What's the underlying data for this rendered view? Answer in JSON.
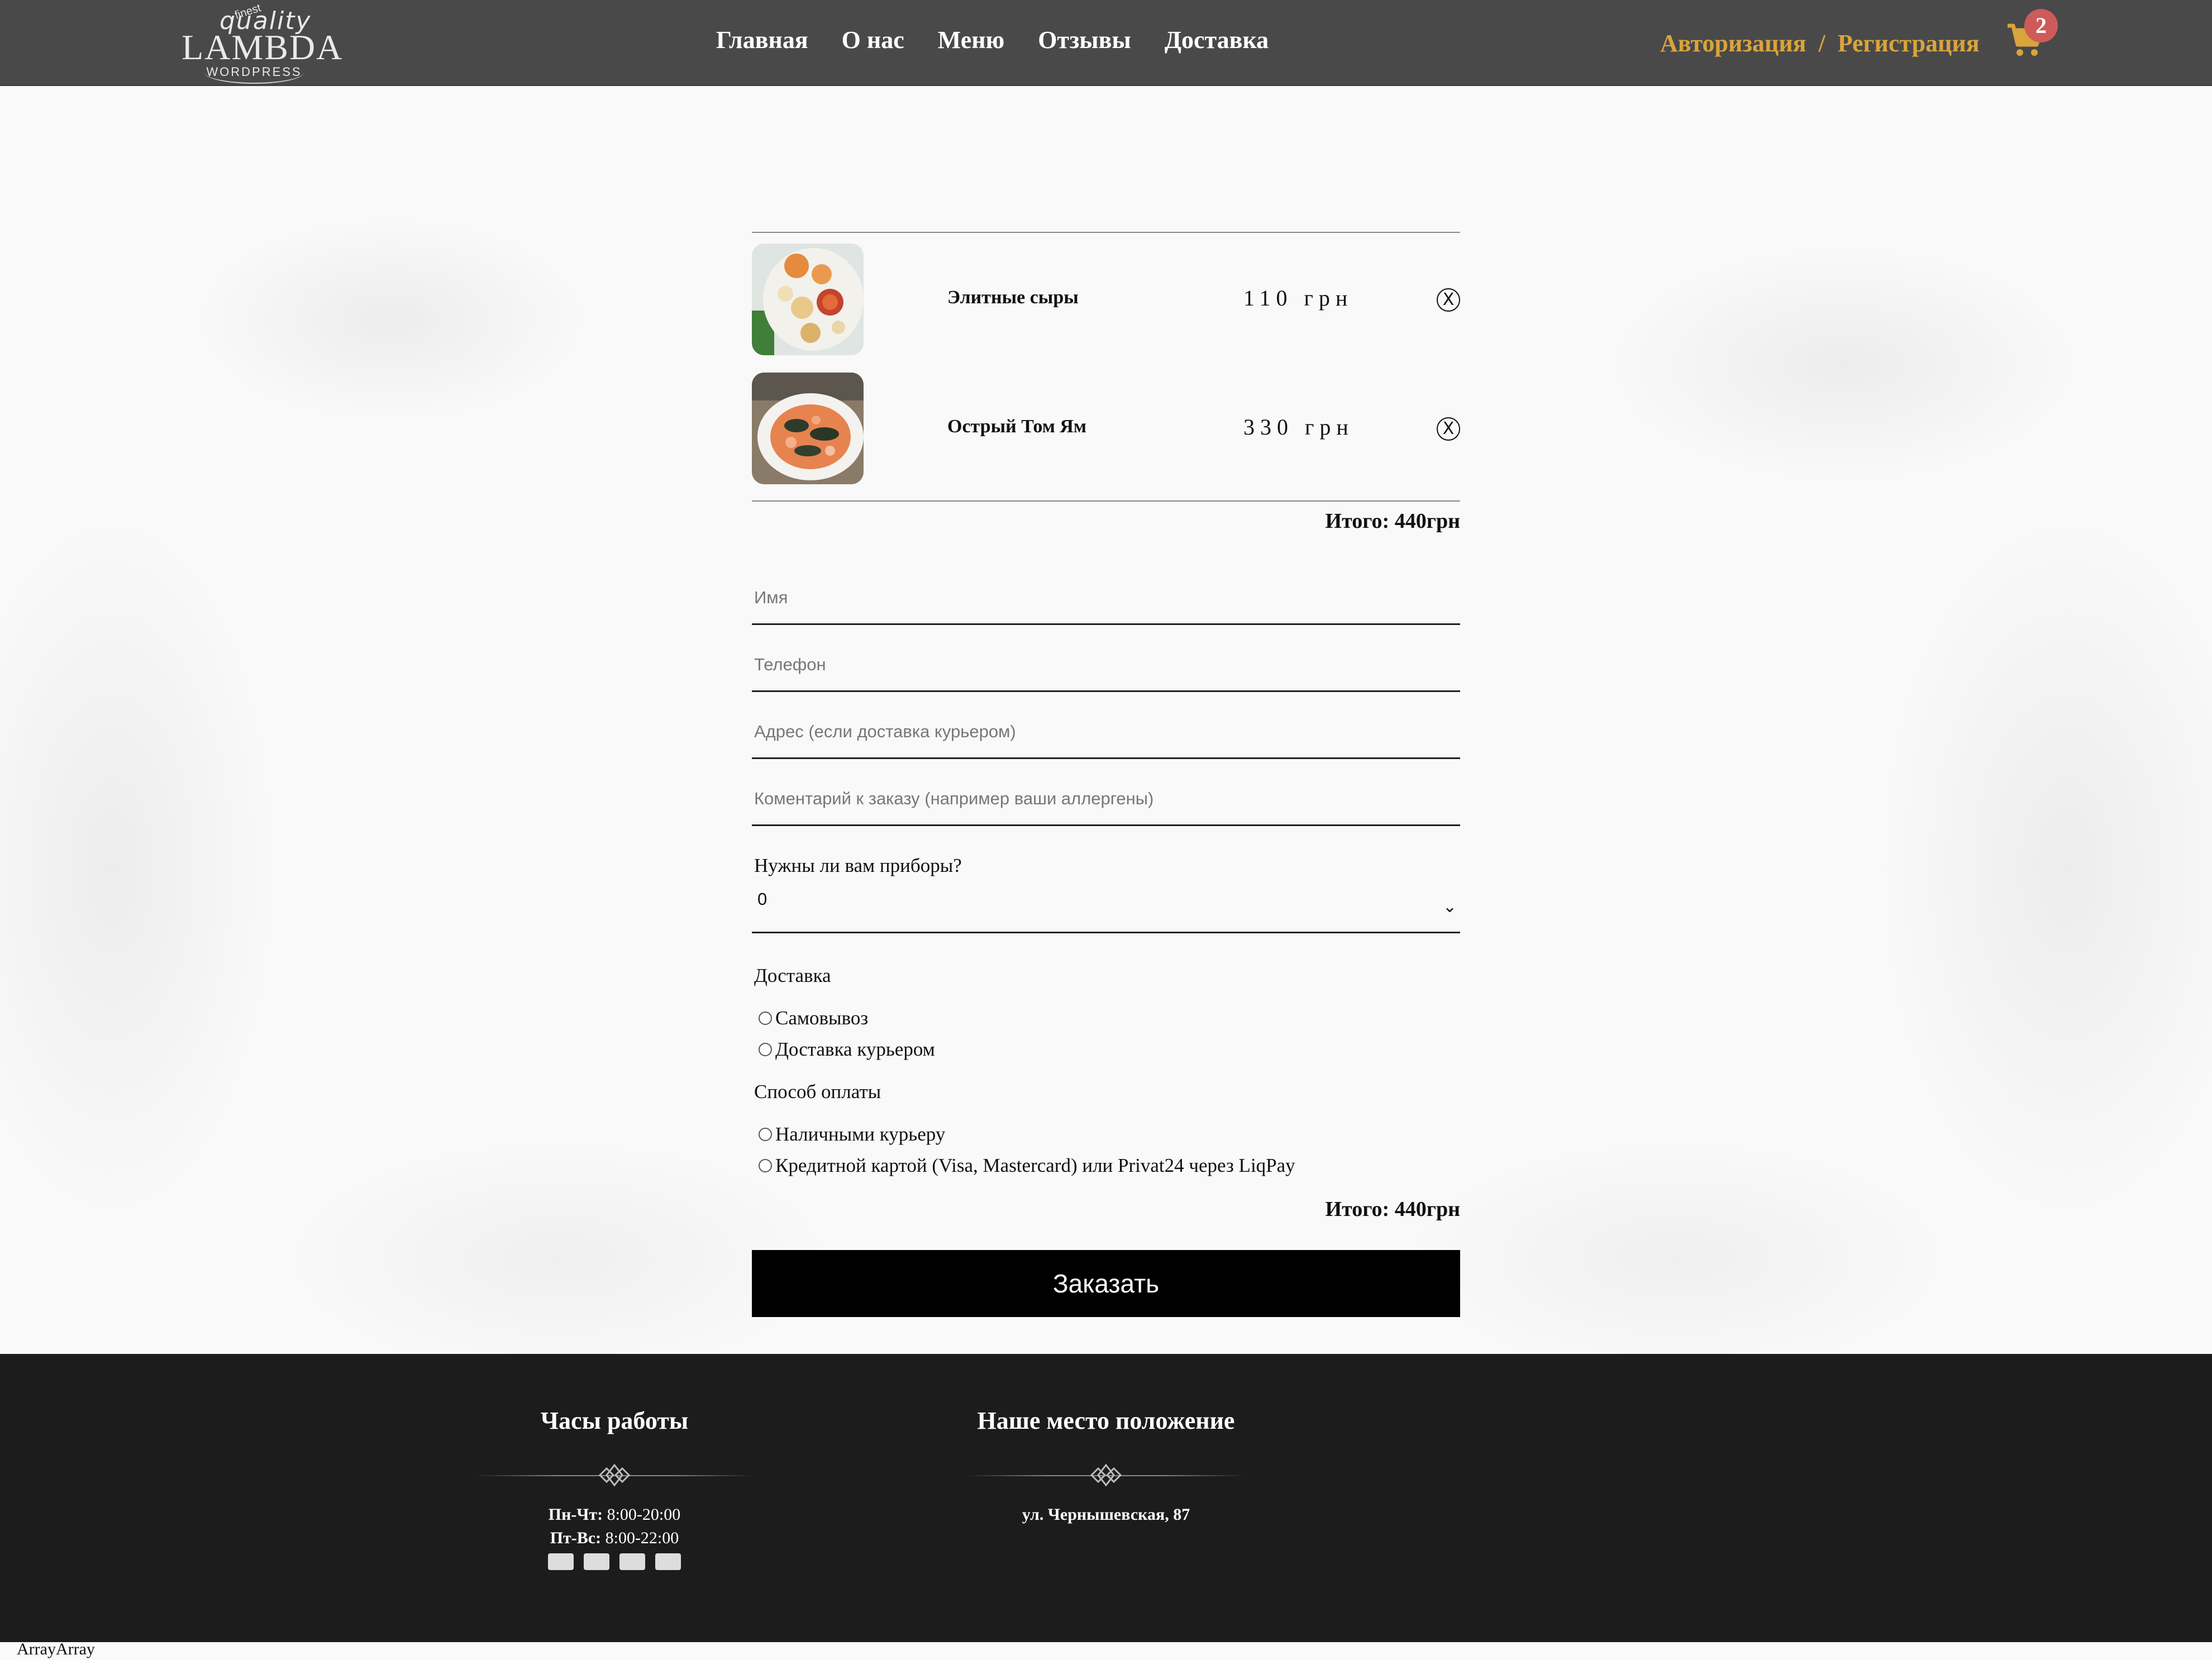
{
  "header": {
    "logo": {
      "finest": "finest",
      "quality": "quality",
      "brand": "LAMBDA",
      "sub": "WORDPRESS"
    },
    "nav": [
      "Главная",
      "О нас",
      "Меню",
      "Отзывы",
      "Доставка"
    ],
    "auth": {
      "login": "Авторизация",
      "separator": "/",
      "register": "Регистрация"
    },
    "cart_icon": "cart-icon",
    "cart_count": "2"
  },
  "cart": {
    "items": [
      {
        "name": "Элитные сыры",
        "price": "110 грн",
        "remove": "X"
      },
      {
        "name": "Острый Том Ям",
        "price": "330 грн",
        "remove": "X"
      }
    ],
    "total": "Итого: 440грн"
  },
  "form": {
    "name_placeholder": "Имя",
    "phone_placeholder": "Телефон",
    "address_placeholder": "Адрес (если доставка курьером)",
    "comment_placeholder": "Коментарий к заказу (например ваши аллергены)",
    "utensils_label": "Нужны ли вам приборы?",
    "utensils_value": "0",
    "delivery_label": "Доставка",
    "delivery_options": [
      "Самовывоз",
      "Доставка курьером"
    ],
    "payment_label": "Способ оплаты",
    "payment_options": [
      "Наличными курьеру",
      "Кредитной картой (Visa, Mastercard) или Privat24 через LiqPay"
    ],
    "total": "Итого: 440грн",
    "submit": "Заказать"
  },
  "footer": {
    "hours_title": "Часы работы",
    "hours": [
      {
        "days": "Пн-Чт:",
        "time": "8:00-20:00"
      },
      {
        "days": "Пт-Вс:",
        "time": "8:00-22:00"
      }
    ],
    "payment_icons": [
      "card-icon",
      "paypal-icon",
      "visa-icon",
      "mastercard-icon"
    ],
    "location_title": "Наше место положение",
    "address": "ул. Чернышевская, 87"
  },
  "debug_text": "ArrayArray",
  "colors": {
    "header_bg": "#494949",
    "accent": "#d9a43c",
    "badge": "#cf5a5a",
    "footer_bg": "#1c1c1c"
  }
}
